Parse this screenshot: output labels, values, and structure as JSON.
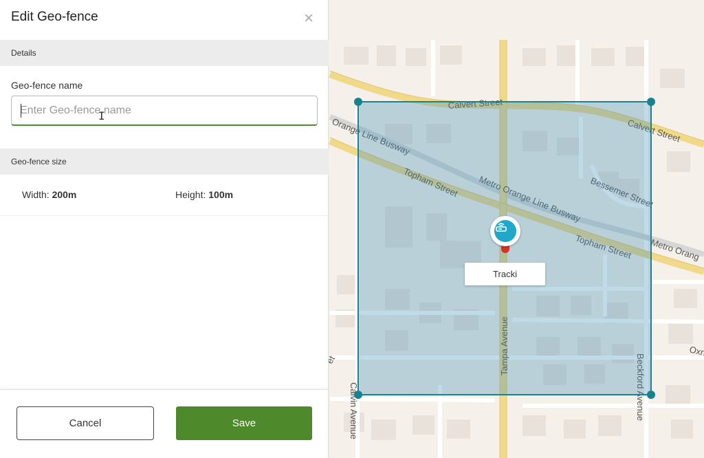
{
  "panel": {
    "title": "Edit Geo-fence",
    "close_icon": "close-icon",
    "details_section": "Details",
    "name_label": "Geo-fence name",
    "name_value": "",
    "name_placeholder": "Enter Geo-fence name",
    "size_section": "Geo-fence size",
    "width_label": "Width:",
    "width_value": "200m",
    "height_label": "Height:",
    "height_value": "100m",
    "cancel_label": "Cancel",
    "save_label": "Save"
  },
  "map": {
    "device_label": "Tracki",
    "device_icon": "router-icon",
    "streets": {
      "calvert_top": "Calvert Street",
      "calvert_right": "Calvert Street",
      "orange_line_left": "Orange Line Busway",
      "orange_line_center": "Metro Orange Line Busway",
      "orange_line_right": "Metro Orang",
      "topham_left": "Topham Street",
      "topham_right": "Topham Street",
      "bessemer": "Bessemer Street",
      "tampa": "Tampa Avenue",
      "beckford": "Beckford Avenue",
      "calvin": "Calvin Avenue",
      "oxnard": "Oxn",
      "fragment_left": "et"
    }
  },
  "colors": {
    "fence_stroke": "#16838f",
    "fence_fill": "rgba(58,140,185,0.32)",
    "road_yellow": "#f1d98a",
    "save_green": "#4e8a2b",
    "pin_blue": "#1fa8c9",
    "pin_red": "#d3352c"
  }
}
